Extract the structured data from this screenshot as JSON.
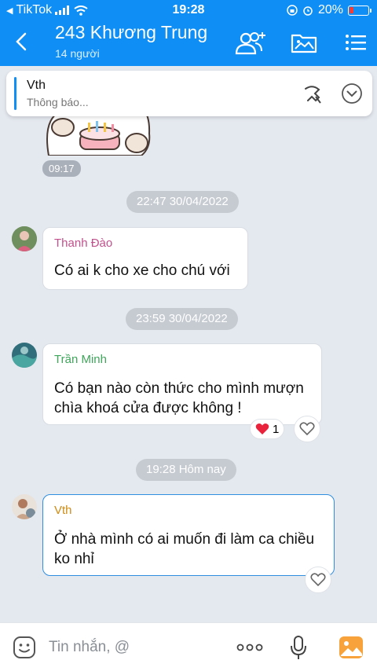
{
  "status_bar": {
    "back_app": "TikTok",
    "time": "19:28",
    "battery": "20%"
  },
  "header": {
    "title": "243 Khương Trung",
    "subtitle": "14 người"
  },
  "pinned": {
    "name": "Vth",
    "description": "Thông báo..."
  },
  "sticker": {
    "time": "09:17"
  },
  "messages": [
    {
      "divider": "22:47 30/04/2022",
      "sender": "Thanh Đào",
      "sender_color": "#c2508c",
      "text": "Có ai k cho xe cho chú với"
    },
    {
      "divider": "23:59 30/04/2022",
      "sender": "Trần Minh",
      "sender_color": "#3ea65a",
      "text_lines": [
        "Có bạn nào còn thức cho mình mượn",
        "chìa khoá cửa được không !"
      ],
      "reaction_count": "1"
    },
    {
      "divider": "19:28 Hôm nay",
      "sender": "Vth",
      "sender_color": "#d18b12",
      "text_lines": [
        "Ở nhà mình có ai muốn đi làm ca chiều",
        "ko nhỉ"
      ]
    }
  ],
  "input": {
    "placeholder": "Tin nhắn, @"
  },
  "colors": {
    "accent": "#0f8ff5",
    "background": "#e4e8ef"
  }
}
